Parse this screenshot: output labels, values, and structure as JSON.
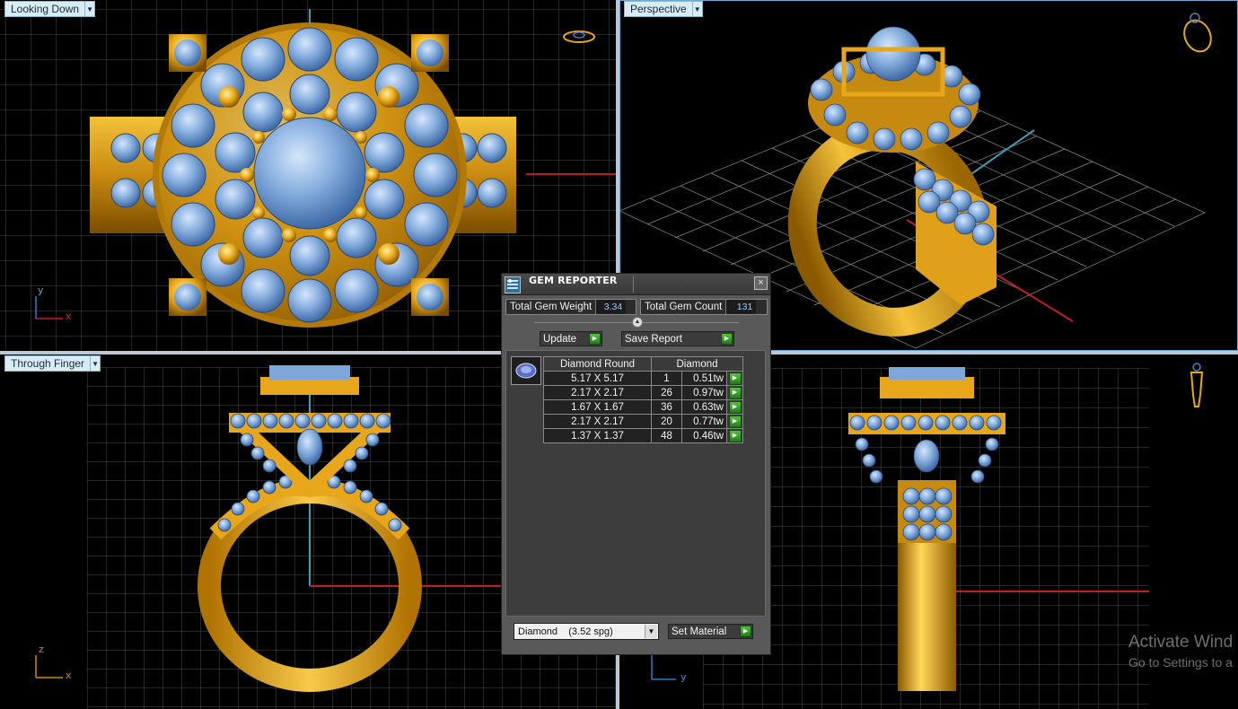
{
  "viewports": {
    "top_left": {
      "label": "Looking Down",
      "axis_a": "y",
      "axis_b": "x"
    },
    "top_right": {
      "label": "Perspective"
    },
    "bottom_left": {
      "label": "Through Finger",
      "axis_a": "z",
      "axis_b": "x"
    },
    "bottom_right": {
      "axis_a": "y"
    }
  },
  "dialog": {
    "title": "GEM REPORTER",
    "close": "×",
    "total_weight_label": "Total Gem Weight",
    "total_weight_value": "3.34",
    "total_count_label": "Total Gem Count",
    "total_count_value": "131",
    "update_label": "Update",
    "save_report_label": "Save Report",
    "table": {
      "header_shape": "Diamond Round",
      "header_material": "Diamond",
      "rows": [
        {
          "size": "5.17 X 5.17",
          "count": "1",
          "weight": "0.51tw"
        },
        {
          "size": "2.17 X 2.17",
          "count": "26",
          "weight": "0.97tw"
        },
        {
          "size": "1.67 X 1.67",
          "count": "36",
          "weight": "0.63tw"
        },
        {
          "size": "2.17 X 2.17",
          "count": "20",
          "weight": "0.77tw"
        },
        {
          "size": "1.37 X 1.37",
          "count": "48",
          "weight": "0.46tw"
        }
      ]
    },
    "material_select": "Diamond    (3.52 spg)",
    "set_material_label": "Set Material"
  },
  "watermark": {
    "line1": "Activate Wind",
    "line2": "Go to Settings to a"
  },
  "colors": {
    "gold": "#e8a61a",
    "gem": "#7fa6d8",
    "grid": "#4d4d4d",
    "axis_red": "#c02020",
    "axis_cyan": "#3aa0b8",
    "label_bg": "#d8ecf6"
  }
}
